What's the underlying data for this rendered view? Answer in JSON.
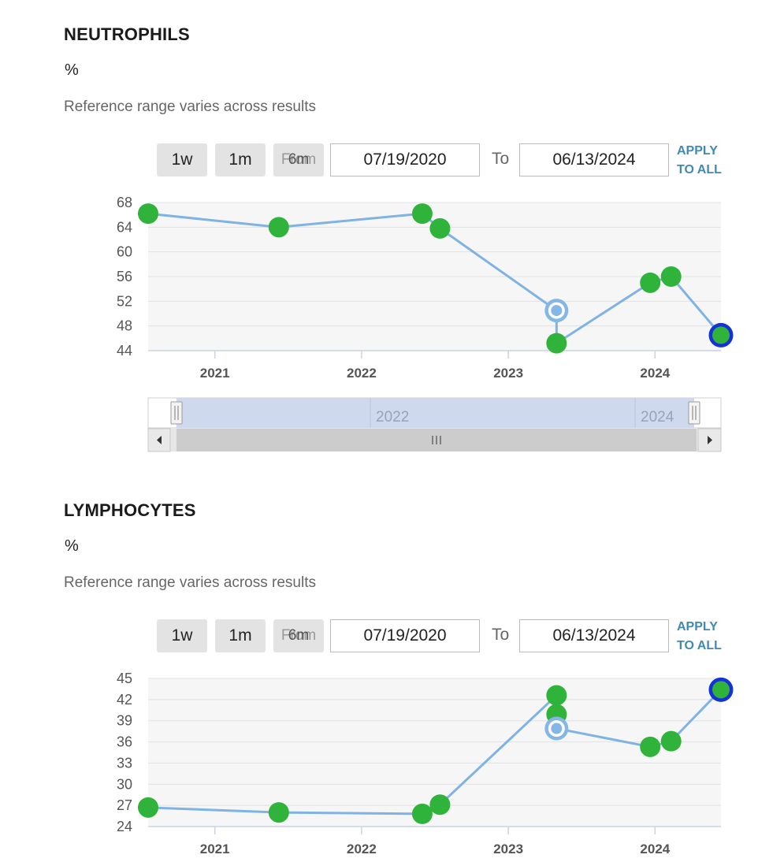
{
  "panels": [
    {
      "title": "NEUTROPHILS",
      "unit": "%",
      "reference_text": "Reference range varies across results",
      "range_buttons": [
        "1w",
        "1m",
        "6m"
      ],
      "from_label": "From",
      "from_date": "07/19/2020",
      "to_label": "To",
      "to_date": "06/13/2024",
      "apply_line1": "APPLY",
      "apply_line2": "TO ALL",
      "navigator": {
        "labels": [
          "2022",
          "2024"
        ]
      }
    },
    {
      "title": "LYMPHOCYTES",
      "unit": "%",
      "reference_text": "Reference range varies across results",
      "range_buttons": [
        "1w",
        "1m",
        "6m"
      ],
      "from_label": "From",
      "from_date": "07/19/2020",
      "to_label": "To",
      "to_date": "06/13/2024",
      "apply_line1": "APPLY",
      "apply_line2": "TO ALL"
    }
  ],
  "colors": {
    "line": "#7fb3e4",
    "point": "#2fb33a",
    "selected_ring": "#1432d6",
    "hover_ring": "#84b6e6",
    "plot_bg": "#f6f6f6",
    "grid": "#e1e1e1",
    "navigator_fill": "#cfd9ee"
  },
  "chart_data": [
    {
      "type": "line",
      "title": "NEUTROPHILS",
      "xlabel": "",
      "ylabel": "%",
      "x": [
        "2020-07-19",
        "2021-06-09",
        "2022-06-01",
        "2022-07-15",
        "2023-05-01",
        "2023-05-01",
        "2023-12-20",
        "2024-02-10",
        "2024-06-13"
      ],
      "y": [
        66.2,
        64.0,
        66.2,
        63.8,
        50.5,
        45.2,
        55.0,
        56.0,
        46.5
      ],
      "hover_point_index": 4,
      "selected_point_index": 8,
      "ylim": [
        44,
        68
      ],
      "yticks": [
        44,
        48,
        52,
        56,
        60,
        64,
        68
      ],
      "xticks": [
        "2021",
        "2022",
        "2023",
        "2024"
      ],
      "grid": true
    },
    {
      "type": "line",
      "title": "LYMPHOCYTES",
      "xlabel": "",
      "ylabel": "%",
      "x": [
        "2020-07-19",
        "2021-06-09",
        "2022-06-01",
        "2022-07-15",
        "2023-05-01",
        "2023-05-01",
        "2023-05-01",
        "2023-12-20",
        "2024-02-10",
        "2024-06-13"
      ],
      "y": [
        26.7,
        26.0,
        25.8,
        27.1,
        42.6,
        39.9,
        37.9,
        35.3,
        36.1,
        43.4
      ],
      "hover_point_index": 6,
      "selected_point_index": 9,
      "ylim": [
        24,
        45
      ],
      "yticks": [
        24,
        27,
        30,
        33,
        36,
        39,
        42,
        45
      ],
      "xticks": [
        "2021",
        "2022",
        "2023",
        "2024"
      ],
      "grid": true
    }
  ]
}
